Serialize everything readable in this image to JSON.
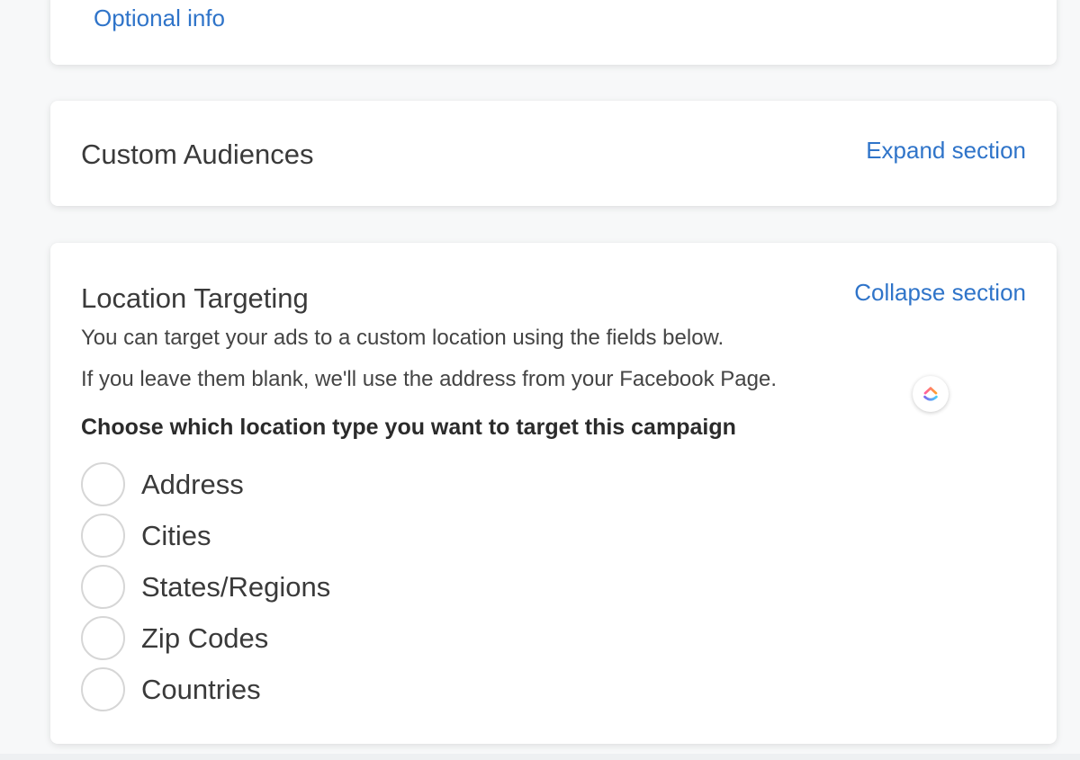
{
  "top_card": {
    "link_label": "Optional info"
  },
  "custom_audiences": {
    "title": "Custom Audiences",
    "toggle_label": "Expand section"
  },
  "location_targeting": {
    "title": "Location Targeting",
    "toggle_label": "Collapse section",
    "description_1": "You can target your ads to a custom location using the fields below.",
    "description_2": "If you leave them blank, we'll use the address from your Facebook Page.",
    "choose_label": "Choose which location type you want to target this campaign",
    "options": [
      {
        "label": "Address"
      },
      {
        "label": "Cities"
      },
      {
        "label": "States/Regions"
      },
      {
        "label": "Zip Codes"
      },
      {
        "label": "Countries"
      }
    ]
  },
  "floating_badge": {
    "icon": "clickup-logo-icon"
  },
  "colors": {
    "link": "#2f74c9",
    "text": "#3a3a3a",
    "radio_border": "#d6d6d6",
    "background": "#f7f8f9"
  }
}
